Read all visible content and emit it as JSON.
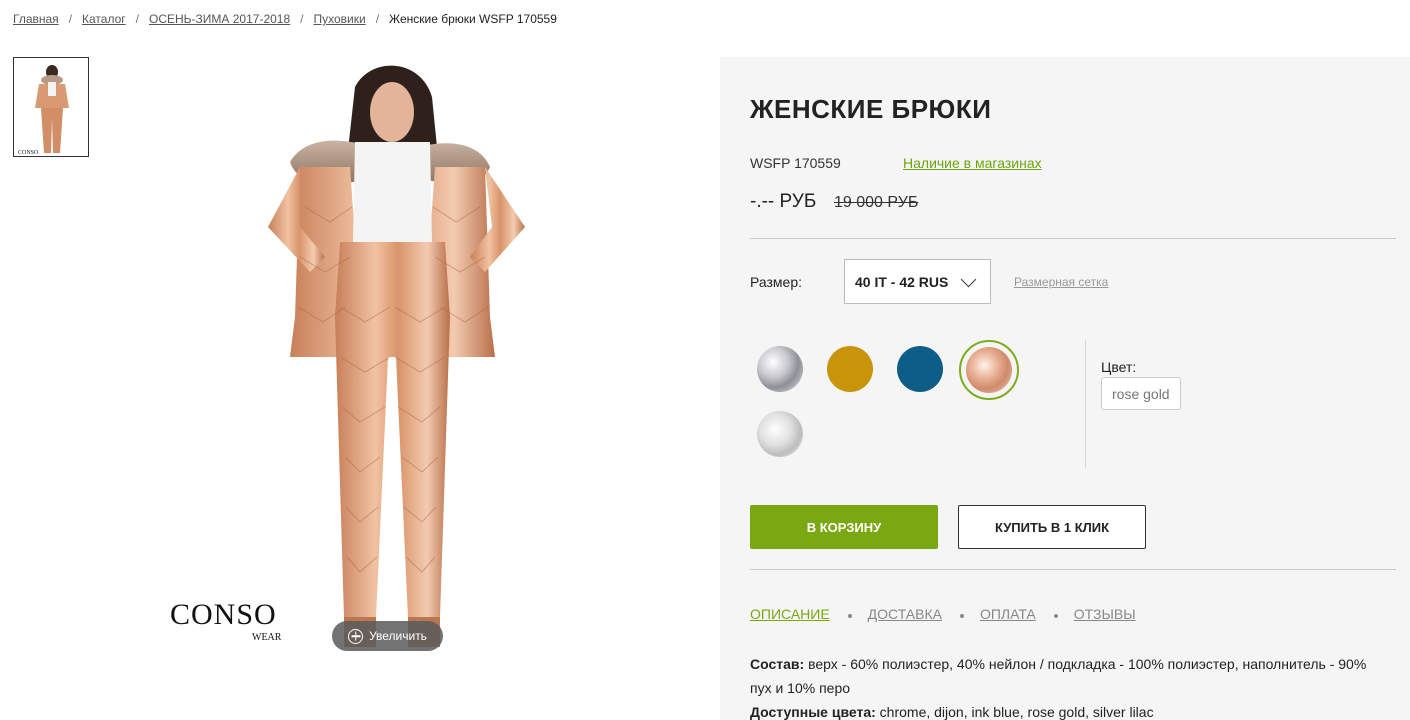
{
  "breadcrumb": {
    "items": [
      "Главная",
      "Каталог",
      "ОСЕНЬ-ЗИМА 2017-2018",
      "Пуховики"
    ],
    "current": "Женские брюки WSFP 170559",
    "separator": "/"
  },
  "gallery": {
    "brand_name": "CONSO",
    "brand_sub": "WEAR",
    "zoom_label": "Увеличить"
  },
  "product": {
    "title": "ЖЕНСКИЕ БРЮКИ",
    "sku": "WSFP 170559",
    "availability": "Наличие в магазинах",
    "price": "-.-- РУБ",
    "old_price": "19 000 РУБ",
    "size_label": "Размер:",
    "size_value": "40 IT - 42 RUS",
    "size_chart": "Размерная сетка",
    "color_label": "Цвет:",
    "color_value": "rose gold",
    "swatches": [
      "chrome",
      "dijon",
      "ink blue",
      "rose gold",
      "silver lilac"
    ],
    "swatch_colors": {
      "dijon": "#c8940a",
      "ink_blue": "#0d5d86",
      "accent": "#7aa813"
    },
    "btn_cart": "В КОРЗИНУ",
    "btn_oneclick": "КУПИТЬ В 1 КЛИК"
  },
  "tabs": [
    "ОПИСАНИЕ",
    "ДОСТАВКА",
    "ОПЛАТА",
    "ОТЗЫВЫ"
  ],
  "description": {
    "composition_label": "Состав:",
    "composition_text": "верх - 60% полиэстер, 40% нейлон / подкладка - 100% полиэстер, наполнитель - 90% пух и 10% перо",
    "colors_label": "Доступные цвета:",
    "colors_text": "chrome, dijon, ink blue, rose gold, silver lilac"
  }
}
